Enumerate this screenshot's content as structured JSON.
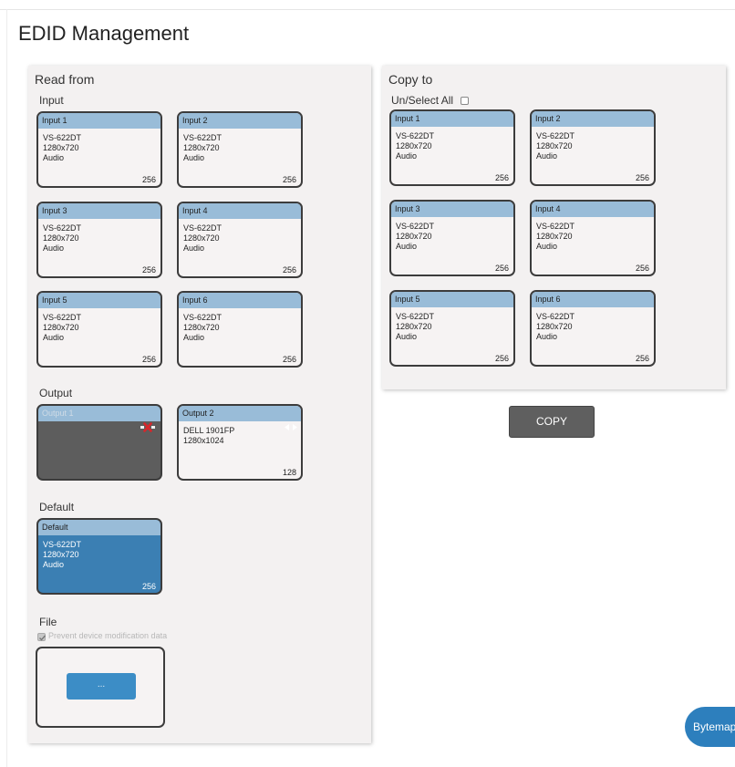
{
  "page_title": "EDID Management",
  "read_from": {
    "title": "Read from",
    "input_label": "Input",
    "inputs": [
      {
        "name": "Input 1",
        "device": "VS-622DT",
        "resolution": "1280x720",
        "audio": "Audio",
        "size": "256"
      },
      {
        "name": "Input 2",
        "device": "VS-622DT",
        "resolution": "1280x720",
        "audio": "Audio",
        "size": "256"
      },
      {
        "name": "Input 3",
        "device": "VS-622DT",
        "resolution": "1280x720",
        "audio": "Audio",
        "size": "256"
      },
      {
        "name": "Input 4",
        "device": "VS-622DT",
        "resolution": "1280x720",
        "audio": "Audio",
        "size": "256"
      },
      {
        "name": "Input 5",
        "device": "VS-622DT",
        "resolution": "1280x720",
        "audio": "Audio",
        "size": "256"
      },
      {
        "name": "Input 6",
        "device": "VS-622DT",
        "resolution": "1280x720",
        "audio": "Audio",
        "size": "256"
      }
    ],
    "output_label": "Output",
    "outputs": [
      {
        "name": "Output 1",
        "state": "disconnected",
        "icon": "disconnected-x-icon"
      },
      {
        "name": "Output 2",
        "device": "DELL 1901FP",
        "resolution": "1280x1024",
        "size": "128",
        "icon": "connected-plug-icon"
      }
    ],
    "default_label": "Default",
    "default": {
      "name": "Default",
      "device": "VS-622DT",
      "resolution": "1280x720",
      "audio": "Audio",
      "size": "256",
      "selected": true
    },
    "file_label": "File",
    "prevent_label": "Prevent device modification data",
    "prevent_checked": true,
    "browse_label": "..."
  },
  "copy_to": {
    "title": "Copy to",
    "select_all_label": "Un/Select All",
    "select_all_checked": false,
    "inputs": [
      {
        "name": "Input 1",
        "device": "VS-622DT",
        "resolution": "1280x720",
        "audio": "Audio",
        "size": "256"
      },
      {
        "name": "Input 2",
        "device": "VS-622DT",
        "resolution": "1280x720",
        "audio": "Audio",
        "size": "256"
      },
      {
        "name": "Input 3",
        "device": "VS-622DT",
        "resolution": "1280x720",
        "audio": "Audio",
        "size": "256"
      },
      {
        "name": "Input 4",
        "device": "VS-622DT",
        "resolution": "1280x720",
        "audio": "Audio",
        "size": "256"
      },
      {
        "name": "Input 5",
        "device": "VS-622DT",
        "resolution": "1280x720",
        "audio": "Audio",
        "size": "256"
      },
      {
        "name": "Input 6",
        "device": "VS-622DT",
        "resolution": "1280x720",
        "audio": "Audio",
        "size": "256"
      }
    ]
  },
  "copy_button": "COPY",
  "bytemap_button": "Bytemap"
}
